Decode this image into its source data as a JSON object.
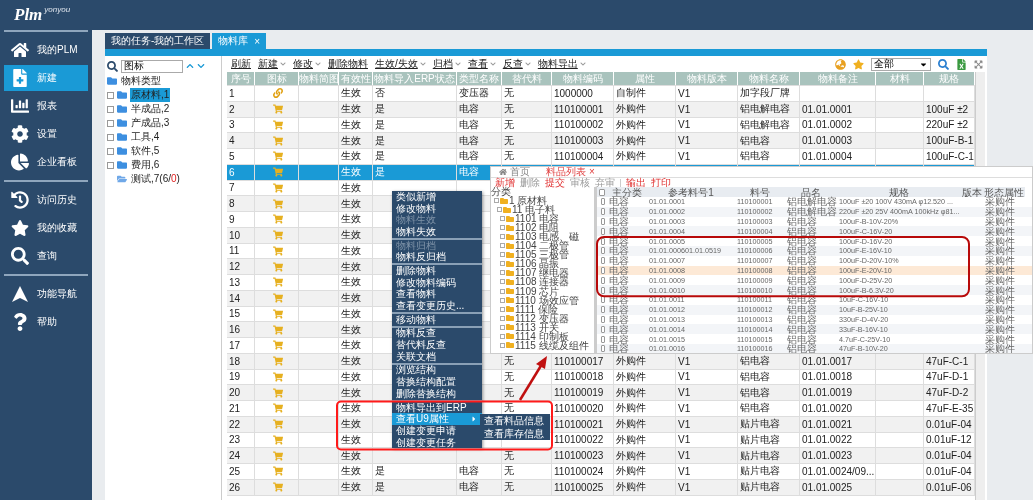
{
  "logo": {
    "name": "Plm",
    "tagline": "yonyou"
  },
  "sidebar": {
    "groups": [
      [
        {
          "label": "我的PLM",
          "kind": "home",
          "selected": false
        },
        {
          "label": "新建",
          "kind": "new",
          "selected": true
        },
        {
          "label": "报表",
          "kind": "report",
          "selected": false
        },
        {
          "label": "设置",
          "kind": "settings",
          "selected": false
        },
        {
          "label": "企业看板",
          "kind": "board",
          "selected": false
        }
      ],
      [
        {
          "label": "访问历史",
          "kind": "history",
          "selected": false
        },
        {
          "label": "我的收藏",
          "kind": "favorite",
          "selected": false
        },
        {
          "label": "查询",
          "kind": "search",
          "selected": false
        }
      ],
      [
        {
          "label": "功能导航",
          "kind": "nav",
          "selected": false
        },
        {
          "label": "帮助",
          "kind": "help",
          "selected": false
        }
      ]
    ]
  },
  "work_tabs": [
    {
      "label": "我的任务-我的工作区",
      "selected": false
    },
    {
      "label": "物料库",
      "selected": true,
      "close": "×"
    }
  ],
  "tree_panel": {
    "search_value": "图标",
    "root": {
      "label": "物料类型",
      "children": [
        {
          "parts": [
            {
              "text": "原材料,1",
              "alert": false
            }
          ],
          "selected": true,
          "kind": "folder"
        },
        {
          "parts": [
            {
              "text": "半成品,2",
              "alert": false
            }
          ],
          "selected": false,
          "kind": "folder"
        },
        {
          "parts": [
            {
              "text": "产成品,3",
              "alert": false
            }
          ],
          "selected": false,
          "kind": "folder"
        },
        {
          "parts": [
            {
              "text": "工具,4",
              "alert": false
            }
          ],
          "selected": false,
          "kind": "folder"
        },
        {
          "parts": [
            {
              "text": "软件,5",
              "alert": false
            }
          ],
          "selected": false,
          "kind": "folder"
        },
        {
          "parts": [
            {
              "text": "费用,6",
              "alert": false
            }
          ],
          "selected": false,
          "kind": "folder"
        },
        {
          "parts": [
            {
              "text": "测试,7(6/",
              "alert": false
            },
            {
              "text": "0",
              "alert": true
            },
            {
              "text": ")",
              "alert": false
            }
          ],
          "selected": false,
          "kind": "open"
        }
      ]
    }
  },
  "toolbar": {
    "items": [
      {
        "label": "刷新",
        "dropdown": false
      },
      {
        "label": "新建",
        "dropdown": true
      },
      {
        "label": "修改",
        "dropdown": true
      },
      {
        "label": "删除物料",
        "dropdown": false
      },
      {
        "label": "生效/失效",
        "dropdown": true
      },
      {
        "label": "归档",
        "dropdown": true
      },
      {
        "label": "查看",
        "dropdown": true
      },
      {
        "label": "反查",
        "dropdown": true
      },
      {
        "label": "物料导出",
        "dropdown": true
      }
    ],
    "filter_value": "全部"
  },
  "table": {
    "columns": [
      "序号",
      "图标",
      "物料简图",
      "有效性",
      "物料导入ERP状态",
      "类型名称",
      "替代料",
      "物料编码",
      "属性",
      "物料版本",
      "物料名称",
      "物料备注",
      "材料",
      "规格"
    ],
    "rows": [
      {
        "selected": false,
        "kind": "assembly",
        "cells": [
          "1",
          null,
          null,
          "生效",
          "否",
          "变压器",
          "无",
          "1000000",
          "自制件",
          "V1",
          "加字段厂牌"
        ]
      },
      {
        "selected": false,
        "kind": "purchased",
        "cells": [
          "2",
          null,
          null,
          "生效",
          "是",
          "电容",
          "无",
          "110100001",
          "外购件",
          "V1",
          "铝电解电容",
          "01.01.0001",
          null,
          "100uF ±2"
        ]
      },
      {
        "selected": false,
        "kind": "purchased",
        "cells": [
          "3",
          null,
          null,
          "生效",
          "是",
          "电容",
          "无",
          "110100002",
          "外购件",
          "V1",
          "铝电解电容",
          "01.01.0002",
          null,
          "220uF ±2"
        ]
      },
      {
        "selected": false,
        "kind": "purchased",
        "cells": [
          "4",
          null,
          null,
          "生效",
          "是",
          "电容",
          "无",
          "110100003",
          "外购件",
          "V1",
          "铝电容",
          "01.01.0003",
          null,
          "100uF-B-1"
        ]
      },
      {
        "selected": false,
        "kind": "purchased",
        "cells": [
          "5",
          null,
          null,
          "生效",
          "是",
          "电容",
          "无",
          "110100004",
          "外购件",
          "V1",
          "铝电容",
          "01.01.0004",
          null,
          "100uF-C-1"
        ]
      },
      {
        "selected": true,
        "kind": "purchased",
        "cells": [
          "6",
          null,
          null,
          "生效",
          "是",
          "电容"
        ]
      },
      {
        "selected": false,
        "kind": "purchased",
        "cells": [
          "7",
          null,
          null,
          "生效"
        ]
      },
      {
        "selected": false,
        "kind": "purchased",
        "cells": [
          "8",
          null,
          null,
          "生效"
        ]
      },
      {
        "selected": false,
        "kind": "purchased",
        "cells": [
          "9",
          null,
          null,
          "生效"
        ]
      },
      {
        "selected": false,
        "kind": "purchased",
        "cells": [
          "10",
          null,
          null,
          "生效"
        ]
      },
      {
        "selected": false,
        "kind": "purchased",
        "cells": [
          "11",
          null,
          null,
          "生效"
        ]
      },
      {
        "selected": false,
        "kind": "purchased",
        "cells": [
          "12",
          null,
          null,
          "生效"
        ]
      },
      {
        "selected": false,
        "kind": "purchased",
        "cells": [
          "13",
          null,
          null,
          "生效"
        ]
      },
      {
        "selected": false,
        "kind": "purchased",
        "cells": [
          "14",
          null,
          null,
          "生效"
        ]
      },
      {
        "selected": false,
        "kind": "purchased",
        "cells": [
          "15",
          null,
          null,
          "生效"
        ]
      },
      {
        "selected": false,
        "kind": "purchased",
        "cells": [
          "16",
          null,
          null,
          "生效"
        ]
      },
      {
        "selected": false,
        "kind": "purchased",
        "cells": [
          "17",
          null,
          null,
          "生效"
        ]
      },
      {
        "selected": false,
        "kind": "purchased",
        "cells": [
          "18",
          null,
          null,
          "生效",
          null,
          null,
          "无",
          "110100017",
          "外购件",
          "V1",
          "铝电容",
          "01.01.0017",
          null,
          "47uF-C-1"
        ]
      },
      {
        "selected": false,
        "kind": "purchased",
        "cells": [
          "19",
          null,
          null,
          "生效",
          null,
          null,
          "无",
          "110100018",
          "外购件",
          "V1",
          "铝电容",
          "01.01.0018",
          null,
          "47uF-D-1"
        ]
      },
      {
        "selected": false,
        "kind": "purchased",
        "cells": [
          "20",
          null,
          null,
          "生效",
          null,
          null,
          "无",
          "110100019",
          "外购件",
          "V1",
          "铝电容",
          "01.01.0019",
          null,
          "47uF-D-2"
        ]
      },
      {
        "selected": false,
        "kind": "purchased",
        "cells": [
          "21",
          null,
          null,
          "生效",
          null,
          null,
          "无",
          "110100020",
          "外购件",
          "V1",
          "铝电容",
          "01.01.0020",
          null,
          "47uF-E-35"
        ]
      },
      {
        "selected": false,
        "kind": "purchased",
        "cells": [
          "22",
          null,
          null,
          "生效",
          null,
          null,
          null,
          "110100021",
          "外购件",
          "V1",
          "贴片电容",
          "01.01.0021",
          null,
          "0.01uF-04"
        ]
      },
      {
        "selected": false,
        "kind": "purchased",
        "cells": [
          "23",
          null,
          null,
          "生效",
          null,
          null,
          null,
          "110100022",
          "外购件",
          "V1",
          "贴片电容",
          "01.01.0022",
          null,
          "0.01uF-12"
        ]
      },
      {
        "selected": false,
        "kind": "purchased",
        "cells": [
          "24",
          null,
          null,
          "生效",
          null,
          null,
          "无",
          "110100023",
          "外购件",
          "V1",
          "贴片电容",
          "01.01.0023",
          null,
          "0.01uF-04"
        ]
      },
      {
        "selected": false,
        "kind": "purchased",
        "cells": [
          "25",
          null,
          null,
          "生效",
          "是",
          "电容",
          "无",
          "110100024",
          "外购件",
          "V1",
          "贴片电容",
          "01.01.0024/09...",
          null,
          "0.01uF-04"
        ]
      },
      {
        "selected": false,
        "kind": "purchased",
        "cells": [
          "26",
          null,
          null,
          "生效",
          "是",
          "电容",
          "无",
          "110100025",
          "外购件",
          "V1",
          "贴片电容",
          "01.01.0025",
          null,
          "0.01uF-06"
        ]
      }
    ]
  },
  "context_menu": {
    "groups": [
      [
        {
          "label": "类似新增",
          "disabled": false,
          "selected": false,
          "has_submenu": false
        },
        {
          "label": "修改物料",
          "disabled": false,
          "selected": false,
          "has_submenu": false
        },
        {
          "label": "物料生效",
          "disabled": true,
          "selected": false,
          "has_submenu": false
        },
        {
          "label": "物料失效",
          "disabled": false,
          "selected": false,
          "has_submenu": false
        }
      ],
      [
        {
          "label": "物料归档",
          "disabled": true,
          "selected": false,
          "has_submenu": false
        },
        {
          "label": "物料反归档",
          "disabled": false,
          "selected": false,
          "has_submenu": false
        }
      ],
      [
        {
          "label": "删除物料",
          "disabled": false,
          "selected": false,
          "has_submenu": false
        },
        {
          "label": "修改物料编码",
          "disabled": false,
          "selected": false,
          "has_submenu": false
        },
        {
          "label": "查看物料",
          "disabled": false,
          "selected": false,
          "has_submenu": false
        },
        {
          "label": "查看变更历史...",
          "disabled": false,
          "selected": false,
          "has_submenu": false
        }
      ],
      [
        {
          "label": "移动物料",
          "disabled": false,
          "selected": false,
          "has_submenu": false
        }
      ],
      [
        {
          "label": "物料反查",
          "disabled": false,
          "selected": false,
          "has_submenu": false
        },
        {
          "label": "替代料反查",
          "disabled": false,
          "selected": false,
          "has_submenu": false
        },
        {
          "label": "关联文档",
          "disabled": false,
          "selected": false,
          "has_submenu": false
        }
      ],
      [
        {
          "label": "浏览结构",
          "disabled": false,
          "selected": false,
          "has_submenu": false
        },
        {
          "label": "替换结构配置",
          "disabled": false,
          "selected": false,
          "has_submenu": false
        },
        {
          "label": "删除替换结构",
          "disabled": false,
          "selected": false,
          "has_submenu": false
        }
      ],
      [
        {
          "label": "物料导出到ERP",
          "disabled": false,
          "selected": false,
          "has_submenu": false
        },
        {
          "label": "查看U9属性",
          "disabled": false,
          "selected": true,
          "has_submenu": true
        },
        {
          "label": "创建变更申请",
          "disabled": false,
          "selected": false,
          "has_submenu": false
        },
        {
          "label": "创建变更任务",
          "disabled": false,
          "selected": false,
          "has_submenu": false
        }
      ]
    ],
    "submenu": [
      {
        "label": "查看料品信息",
        "selected": false
      },
      {
        "label": "查看库存信息",
        "selected": false
      }
    ]
  },
  "inset_window": {
    "tabs": [
      {
        "label": "首页",
        "selected": false
      },
      {
        "label": "料品列表",
        "selected": true,
        "close": "×"
      }
    ],
    "toolbar": [
      [
        {
          "label": "新增",
          "disabled": false
        },
        {
          "label": "删除",
          "disabled": true
        },
        {
          "label": "提交",
          "disabled": false
        },
        {
          "label": "审核",
          "disabled": true
        },
        {
          "label": "弃审",
          "disabled": true
        }
      ],
      [
        {
          "label": "输出",
          "disabled": false
        },
        {
          "label": "打印",
          "disabled": false
        }
      ]
    ],
    "tree": {
      "label": "分类",
      "children": [
        {
          "label": "1 原材料",
          "children": [
            {
              "label": "11 电子料",
              "children": [
                {
                  "label": "1101 电容"
                },
                {
                  "label": "1102 电阻"
                },
                {
                  "label": "1103 电感、磁"
                },
                {
                  "label": "1104 二极管"
                },
                {
                  "label": "1105 三极管"
                },
                {
                  "label": "1106 晶振"
                },
                {
                  "label": "1107 继电器"
                },
                {
                  "label": "1108 连接器"
                },
                {
                  "label": "1109 芯片"
                },
                {
                  "label": "1110 场效应管"
                },
                {
                  "label": "1111 保险"
                },
                {
                  "label": "1112 变压器"
                },
                {
                  "label": "1113 开关"
                },
                {
                  "label": "1114 印制板"
                },
                {
                  "label": "1115 线缆及组件"
                }
              ]
            }
          ]
        }
      ]
    },
    "all_checked": false,
    "columns": [
      "主分类",
      "参考料号1",
      "料号",
      "品名",
      "规格",
      "版本",
      "形态属性"
    ],
    "rows": [
      {
        "checked": false,
        "selected": false,
        "cells": [
          "电容",
          "01.01.0001",
          "110100001",
          "铝电解电容",
          "100uF ±20 100V 430mA φ12.520 ...",
          null,
          "采购件"
        ]
      },
      {
        "checked": false,
        "selected": false,
        "cells": [
          "电容",
          "01.01.0002",
          "110100002",
          "铝电解电容",
          "220uF ±20 25V 400mA 100kHz φ81...",
          null,
          "采购件"
        ]
      },
      {
        "checked": false,
        "selected": false,
        "cells": [
          "电容",
          "01.01.0003",
          "110100003",
          "铝电容",
          "100uF-B-10V-20%",
          null,
          "采购件"
        ]
      },
      {
        "checked": false,
        "selected": false,
        "cells": [
          "电容",
          "01.01.0004",
          "110100004",
          "铝电容",
          "100uF-C-16V-20",
          null,
          "采购件"
        ]
      },
      {
        "checked": false,
        "selected": false,
        "cells": [
          "电容",
          "01.01.0005",
          "110100005",
          "铝电容",
          "100uF-D-16V-20",
          null,
          "采购件"
        ]
      },
      {
        "checked": false,
        "selected": false,
        "cells": [
          "电容",
          "01.01.000601.01.0519",
          "110100006",
          "铝电容",
          "100uF-E-16V-10",
          null,
          "采购件"
        ]
      },
      {
        "checked": false,
        "selected": false,
        "cells": [
          "电容",
          "01.01.0007",
          "110100007",
          "铝电容",
          "100uF-D-20V-10%",
          null,
          "采购件"
        ]
      },
      {
        "checked": false,
        "selected": true,
        "cells": [
          "电容",
          "01.01.0008",
          "110100008",
          "铝电容",
          "100uF-E-20V-10",
          null,
          "采购件"
        ]
      },
      {
        "checked": false,
        "selected": false,
        "cells": [
          "电容",
          "01.01.0009",
          "110100009",
          "铝电容",
          "100uF-D-25V-20",
          null,
          "采购件"
        ]
      },
      {
        "checked": false,
        "selected": false,
        "cells": [
          "电容",
          "01.01.0010",
          "110100010",
          "铝电容",
          "100uF-B-6.3V-20",
          null,
          "采购件"
        ]
      },
      {
        "checked": false,
        "selected": false,
        "cells": [
          "电容",
          "01.01.0011",
          "110100011",
          "铝电容",
          "10uF-C-16V-10",
          null,
          "采购件"
        ]
      },
      {
        "checked": false,
        "selected": false,
        "cells": [
          "电容",
          "01.01.0012",
          "110100012",
          "铝电容",
          "10uF-B-25V-10",
          null,
          "采购件"
        ]
      },
      {
        "checked": false,
        "selected": false,
        "cells": [
          "电容",
          "01.01.0013",
          "110100013",
          "铝电容",
          "330uF-D-4V-20",
          null,
          "采购件"
        ]
      },
      {
        "checked": false,
        "selected": false,
        "cells": [
          "电容",
          "01.01.0014",
          "110100014",
          "铝电容",
          "33uF-B-16V-10",
          null,
          "采购件"
        ]
      },
      {
        "checked": false,
        "selected": false,
        "cells": [
          "电容",
          "01.01.0015",
          "110100015",
          "铝电容",
          "4.7uF-C-25V-10",
          null,
          "采购件"
        ]
      },
      {
        "checked": false,
        "selected": false,
        "cells": [
          "电容",
          "01.01.0016",
          "110100016",
          "铝电容",
          "47uF-B-10V-20",
          null,
          "采购件"
        ]
      }
    ]
  }
}
